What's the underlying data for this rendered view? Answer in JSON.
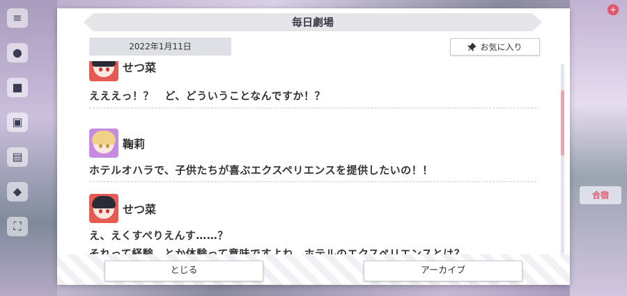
{
  "dialog": {
    "title": "毎日劇場",
    "date": "2022年1月11日",
    "favorite_label": "お気に入り",
    "close_label": "とじる",
    "archive_label": "アーカイブ"
  },
  "entries": [
    {
      "speaker": "せつ菜",
      "lines": [
        "えええっ！？　ど、どういうことなんですか！？"
      ]
    },
    {
      "speaker": "鞠莉",
      "lines": [
        "ホテルオハラで、子供たちが喜ぶエクスペリエンスを提供したいの！！"
      ]
    },
    {
      "speaker": "せつ菜",
      "lines": [
        "え、えくすぺりえんす……？",
        "それって経験、とか体験って意味ですよね。ホテルのエクスペリエンスとは？"
      ]
    }
  ],
  "background": {
    "right_tile_label": "合宿",
    "badge": "+"
  },
  "colors": {
    "accent": "#f0a3ab",
    "setsuna": "#e55a52",
    "mari": "#c889e2"
  }
}
